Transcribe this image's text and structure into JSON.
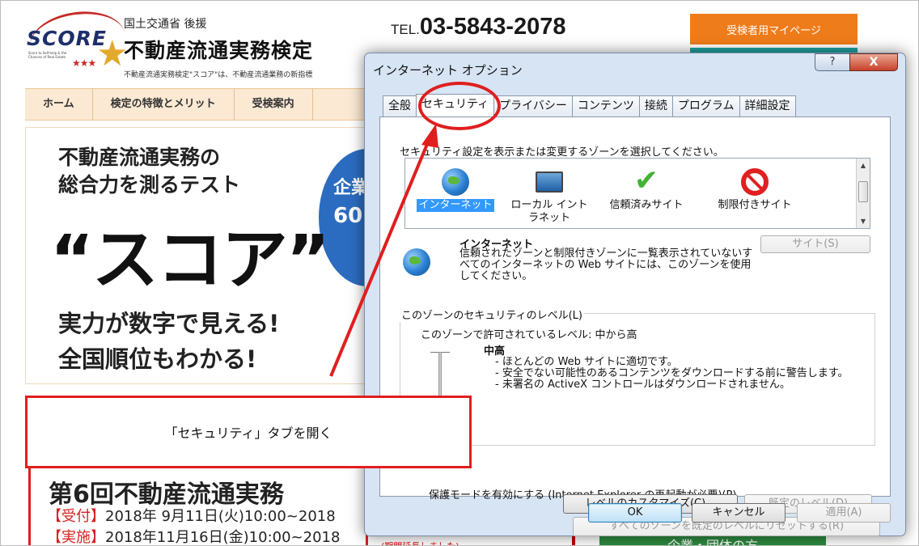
{
  "website": {
    "logo_text": "SCORE",
    "logo_sub": "Score to Self-help & the Chances of Real Estate",
    "sponsor": "国土交通省 後援",
    "title": "不動産流通実務検定",
    "desc": "不動産流通実務検定\"スコア\"は、不動産流通業務の新指標",
    "tel_prefix": "TEL.",
    "tel": "03-5843-2078",
    "mypage_button": "受検者用マイページ",
    "nav": [
      "ホーム",
      "検定の特徴とメリット",
      "受検案内"
    ],
    "hero_line1": "不動産流通実務の",
    "hero_line2": "総合力を測るテスト",
    "hero_quote": "“スコア”",
    "hero_line3": "実力が数字で見える!",
    "hero_line4": "全国順位もわかる!",
    "badge_text1": "企業",
    "badge_text2": "60",
    "event_title": "第6回不動産流通実務",
    "event_reception_tag": "【受付】",
    "event_reception": "2018年 9月11日(火)10:00~2018",
    "event_exam_tag": "【実施】",
    "event_exam": "2018年11月16日(金)10:00~2018",
    "extended_note": "(期間延長しました)",
    "green_strip": "企業・団体の方"
  },
  "dialog": {
    "title": "インターネット オプション",
    "help": "?",
    "close": "X",
    "tabs": [
      "全般",
      "セキュリティ",
      "プライバシー",
      "コンテンツ",
      "接続",
      "プログラム",
      "詳細設定"
    ],
    "active_tab": "セキュリティ",
    "prompt": "セキュリティ設定を表示または変更するゾーンを選択してください。",
    "zones": [
      {
        "label": "インターネット",
        "icon": "globe-icon",
        "selected": true
      },
      {
        "label": "ローカル イントラネット",
        "icon": "intranet-icon",
        "selected": false
      },
      {
        "label": "信頼済みサイト",
        "icon": "checkmark-icon",
        "selected": false
      },
      {
        "label": "制限付きサイト",
        "icon": "restricted-icon",
        "selected": false
      }
    ],
    "zone_info_title": "インターネット",
    "zone_info_desc": "信頼されたゾーンと制限付きゾーンに一覧表示されていないすべてのインターネットの Web サイトには、このゾーンを使用してください。",
    "sites_button": "サイト(S)",
    "level_group_legend": "このゾーンのセキュリティのレベル(L)",
    "allowed_levels": "このゾーンで許可されているレベル: 中から高",
    "level_name": "中高",
    "level_desc": [
      "- ほとんどの Web サイトに適切です。",
      "- 安全でない可能性のあるコンテンツをダウンロードする前に警告します。",
      "- 未署名の ActiveX コントロールはダウンロードされません。"
    ],
    "protected_mode": "保護モードを有効にする (Internet Explorer の再起動が必要)(P)",
    "custom_level_button": "レベルのカスタマイズ(C)...",
    "default_level_button": "既定のレベル(D)",
    "reset_all_button": "すべてのゾーンを既定のレベルにリセットする(R)",
    "ok_button": "OK",
    "cancel_button": "キャンセル",
    "apply_button": "適用(A)"
  },
  "annotation": {
    "callout_text": "「セキュリティ」タブを開く"
  },
  "colors": {
    "accent_red": "#e01e1e",
    "orange": "#ef7c1a",
    "teal": "#1ea3a1",
    "selection_blue": "#3399ff"
  }
}
